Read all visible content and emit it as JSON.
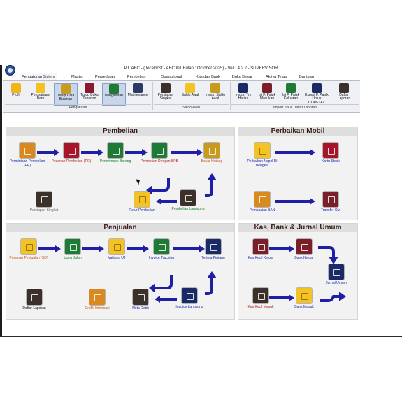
{
  "window": {
    "title": "PT. ABC - ( localhost - ABC001  Bulan : October 2025)  - Ver : 4.2.2 - SUPERVISOR"
  },
  "menu": [
    {
      "label": "Pengaturan Sistem",
      "active": true
    },
    {
      "label": "Master"
    },
    {
      "label": "Persediaan"
    },
    {
      "label": "Pembelian"
    },
    {
      "label": "Operasional"
    },
    {
      "label": "Kas dan Bank"
    },
    {
      "label": "Buku Besar"
    },
    {
      "label": "Aktiva Tetap"
    },
    {
      "label": "Bantuan"
    }
  ],
  "ribbon": {
    "buttons": [
      {
        "label": "Profil",
        "icon": "profile-icon"
      },
      {
        "label": "Perusahaan Baru",
        "icon": "new-company-icon"
      },
      {
        "label": "Tutup Data Bulanan",
        "icon": "monthly-close-icon",
        "selected": true
      },
      {
        "label": "Tutup Buku Tahunan",
        "icon": "yearly-close-icon"
      },
      {
        "label": "Pengaturan",
        "icon": "settings-icon",
        "selected": true
      },
      {
        "label": "Maintenance",
        "icon": "maintenance-icon"
      },
      {
        "label": "Persiapan Singkat",
        "icon": "quick-setup-icon"
      },
      {
        "label": "Saldo Awal",
        "icon": "opening-balance-icon"
      },
      {
        "label": "Import Saldo Awal",
        "icon": "import-opening-balance-icon"
      },
      {
        "label": "Import Trx Harian",
        "icon": "import-daily-icon"
      },
      {
        "label": "Isi F. Pajak Masukan",
        "icon": "input-tax-icon"
      },
      {
        "label": "Isi F. Pajak Keluaran",
        "icon": "output-tax-icon"
      },
      {
        "label": "Export F. Pajak Untuk CORETAX",
        "icon": "export-tax-icon"
      },
      {
        "label": "Daftar Laporan",
        "icon": "report-list-icon"
      }
    ],
    "groups": {
      "pengaturan": "Pengaturan",
      "saldo_awal": "Saldo Awal",
      "import": "Import Trx & Daftar Laporan"
    }
  },
  "panels": {
    "pembelian": {
      "title": "Pembelian",
      "nodes": {
        "pr": "Permintaan Pembelian (PR)",
        "po": "Pesanan Pembelian (PO)",
        "penerimaan": "Penerimaan Barang",
        "bpb": "Pembelian Dengan BPB",
        "bayar": "Bayar Hutang",
        "retur": "Retur Pembelian",
        "langsung": "Pembelian Langsung",
        "persiapan": "Persiapan Singkat"
      }
    },
    "perbaikan": {
      "title": "Perbaikan Mobil",
      "nodes": {
        "nopol": "Perbaikan Nopol Di Bengkel",
        "kartu": "Kartu Stock",
        "ban": "Pemakaian BAN",
        "transfer": "Transfer Out"
      }
    },
    "penjualan": {
      "title": "Penjualan",
      "nodes": {
        "so": "Pesanan Penjualan (SO)",
        "uang_jalan": "Uang Jalan",
        "validasi": "Validasi UJ",
        "invoice_trucking": "Invoice Trucking",
        "terima": "Terima Piutang",
        "laporan": "Daftar Laporan",
        "grafik": "Grafik Informasi",
        "nota": "Nota Debit",
        "invoice_langsung": "Invoice Langsung"
      }
    },
    "kas": {
      "title": "Kas, Bank & Jurnal Umum",
      "nodes": {
        "kas_keluar": "Kas Kecil Keluar",
        "bank_keluar": "Bank Keluar",
        "jurnal": "Jurnal Umum",
        "kas_masuk": "Kas Kecil Masuk",
        "bank_masuk": "Bank Masuk"
      }
    }
  }
}
